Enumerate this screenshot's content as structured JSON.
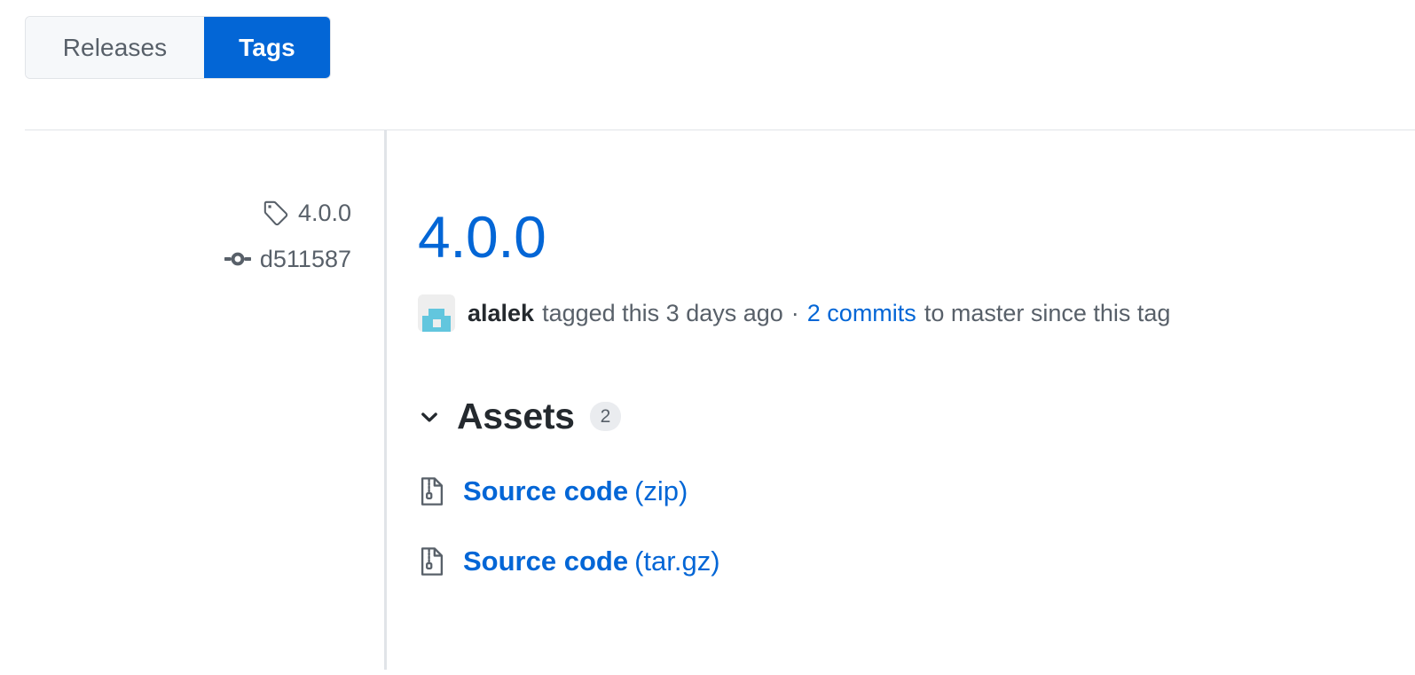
{
  "tabs": [
    {
      "id": "releases",
      "label": "Releases",
      "selected": false
    },
    {
      "id": "tags",
      "label": "Tags",
      "selected": true
    }
  ],
  "sidebar": {
    "tag": {
      "icon": "tag-icon",
      "label": "4.0.0"
    },
    "commit": {
      "icon": "git-commit-icon",
      "label": "d511587"
    }
  },
  "release": {
    "title": "4.0.0",
    "byline": {
      "avatar_alt": "alalek",
      "author": "alalek",
      "action_text": "tagged this 3 days ago",
      "separator": "·",
      "commits_link": "2 commits",
      "trailing_text": "to master since this tag"
    }
  },
  "assets": {
    "chevron_icon": "chevron-down-icon",
    "heading": "Assets",
    "count": "2",
    "items": [
      {
        "icon": "file-zip-icon",
        "name": "Source code",
        "ext": "(zip)"
      },
      {
        "icon": "file-zip-icon",
        "name": "Source code",
        "ext": "(tar.gz)"
      }
    ]
  },
  "colors": {
    "accent_blue": "#0366d6",
    "muted_gray": "#586069",
    "border_gray": "#e1e4e8",
    "tab_bg": "#f6f8fa",
    "badge_bg": "#eaecef",
    "avatar_teal": "#62c6de"
  }
}
